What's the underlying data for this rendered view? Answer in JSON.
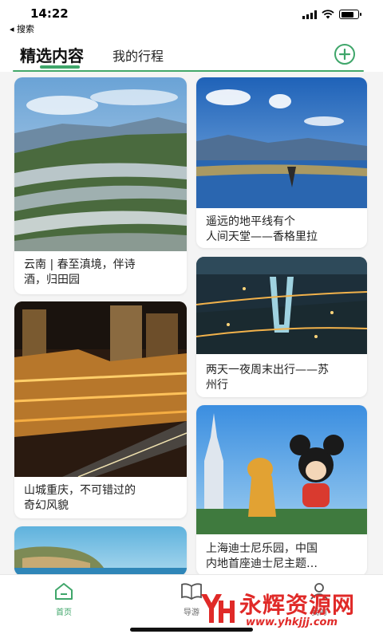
{
  "status_bar": {
    "time": "14:22",
    "back_label": "◂ 搜索",
    "battery_level_percent": 75
  },
  "header": {
    "tabs": [
      "精选内容",
      "我的行程"
    ],
    "active_tab": 0,
    "add_icon": "plus-circle-icon"
  },
  "cards": [
    {
      "title": "云南 | 春至滇境，伴诗\n酒，归田园",
      "image": "rice-terraces-photo"
    },
    {
      "title": "遥远的地平线有个\n人间天堂——香格里拉",
      "image": "lake-sky-photo"
    },
    {
      "title": "山城重庆，不可错过的\n奇幻风貌",
      "image": "chongqing-night-photo"
    },
    {
      "title": "两天一夜周末出行——苏\n州行",
      "image": "suzhou-night-aerial-photo"
    },
    {
      "title": "",
      "image": "coast-island-photo"
    },
    {
      "title": "上海迪士尼乐园，中国\n内地首座迪士尼主题…",
      "image": "disney-mickey-pluto-photo"
    }
  ],
  "tabbar": [
    {
      "label": "首页",
      "icon": "home-icon"
    },
    {
      "label": "导游",
      "icon": "book-icon"
    },
    {
      "label": "我的",
      "icon": "user-icon"
    }
  ],
  "watermark": {
    "text": "永辉资源网",
    "url": "www.yhkjjj.com",
    "logo": "yh-logo"
  },
  "colors": {
    "accent": "#3fa66a",
    "watermark_red": "#e02a28"
  }
}
